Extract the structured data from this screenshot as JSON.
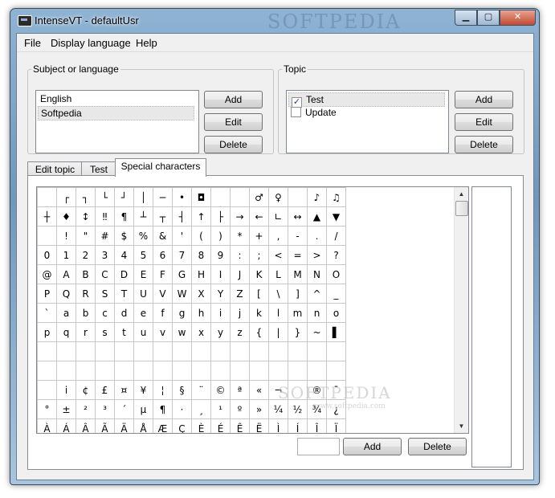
{
  "window": {
    "title": "IntenseVT - defaultUsr",
    "min": "▁",
    "max": "▢",
    "close": "✕"
  },
  "menu": [
    "File",
    "Display language",
    "Help"
  ],
  "subject": {
    "legend": "Subject or language",
    "items": [
      "English",
      "Softpedia"
    ],
    "add": "Add",
    "edit": "Edit",
    "delete": "Delete"
  },
  "topic": {
    "legend": "Topic",
    "items": [
      {
        "label": "Test",
        "checked": true
      },
      {
        "label": "Update",
        "checked": false
      }
    ],
    "add": "Add",
    "edit": "Edit",
    "delete": "Delete"
  },
  "tabs": [
    "Edit topic",
    "Test",
    "Special characters"
  ],
  "special": {
    "rows": [
      [
        "",
        "┌",
        "┐",
        "└",
        "┘",
        "│",
        "─",
        "•",
        "◘",
        "",
        "",
        "♂",
        "♀",
        "",
        "♪",
        "♫"
      ],
      [
        "┼",
        "♦",
        "↕",
        "‼",
        "¶",
        "┴",
        "┬",
        "┤",
        "↑",
        "├",
        "→",
        "←",
        "∟",
        "↔",
        "▲",
        "▼"
      ],
      [
        "",
        "!",
        "\"",
        "#",
        "$",
        "%",
        "&",
        "'",
        "(",
        ")",
        "*",
        "+",
        ",",
        "-",
        ".",
        "/"
      ],
      [
        "0",
        "1",
        "2",
        "3",
        "4",
        "5",
        "6",
        "7",
        "8",
        "9",
        ":",
        ";",
        "<",
        "=",
        ">",
        "?"
      ],
      [
        "@",
        "A",
        "B",
        "C",
        "D",
        "E",
        "F",
        "G",
        "H",
        "I",
        "J",
        "K",
        "L",
        "M",
        "N",
        "O"
      ],
      [
        "P",
        "Q",
        "R",
        "S",
        "T",
        "U",
        "V",
        "W",
        "X",
        "Y",
        "Z",
        "[",
        "\\",
        "]",
        "^",
        "_"
      ],
      [
        "`",
        "a",
        "b",
        "c",
        "d",
        "e",
        "f",
        "g",
        "h",
        "i",
        "j",
        "k",
        "l",
        "m",
        "n",
        "o"
      ],
      [
        "p",
        "q",
        "r",
        "s",
        "t",
        "u",
        "v",
        "w",
        "x",
        "y",
        "z",
        "{",
        "|",
        "}",
        "~",
        "▌"
      ],
      [
        "",
        "",
        "",
        "",
        "",
        "",
        "",
        "",
        "",
        "",
        "",
        "",
        "",
        "",
        "",
        ""
      ],
      [
        "",
        "",
        "",
        "",
        "",
        "",
        "",
        "",
        "",
        "",
        "",
        "",
        "",
        "",
        "",
        ""
      ],
      [
        "",
        "i",
        "¢",
        "£",
        "¤",
        "¥",
        "¦",
        "§",
        "¨",
        "©",
        "ª",
        "«",
        "¬",
        "",
        "®",
        "¯"
      ],
      [
        "°",
        "±",
        "²",
        "³",
        "´",
        "µ",
        "¶",
        "·",
        "¸",
        "¹",
        "º",
        "»",
        "¼",
        "½",
        "¾",
        "¿"
      ],
      [
        "À",
        "Á",
        "Â",
        "Ã",
        "Ä",
        "Å",
        "Æ",
        "Ç",
        "È",
        "É",
        "Ê",
        "Ë",
        "Ì",
        "Í",
        "Î",
        "Ï"
      ]
    ],
    "input_value": "",
    "add": "Add",
    "delete": "Delete"
  },
  "watermarks": {
    "title_bar": "SOFTPEDIA",
    "grid": "SOFTPEDIA",
    "url": "www.softpedia.com"
  },
  "colors": {
    "title_gradient_top": "#8fb3d3",
    "client_bg": "#f0f0f0",
    "close_btn": "#c24a30"
  }
}
